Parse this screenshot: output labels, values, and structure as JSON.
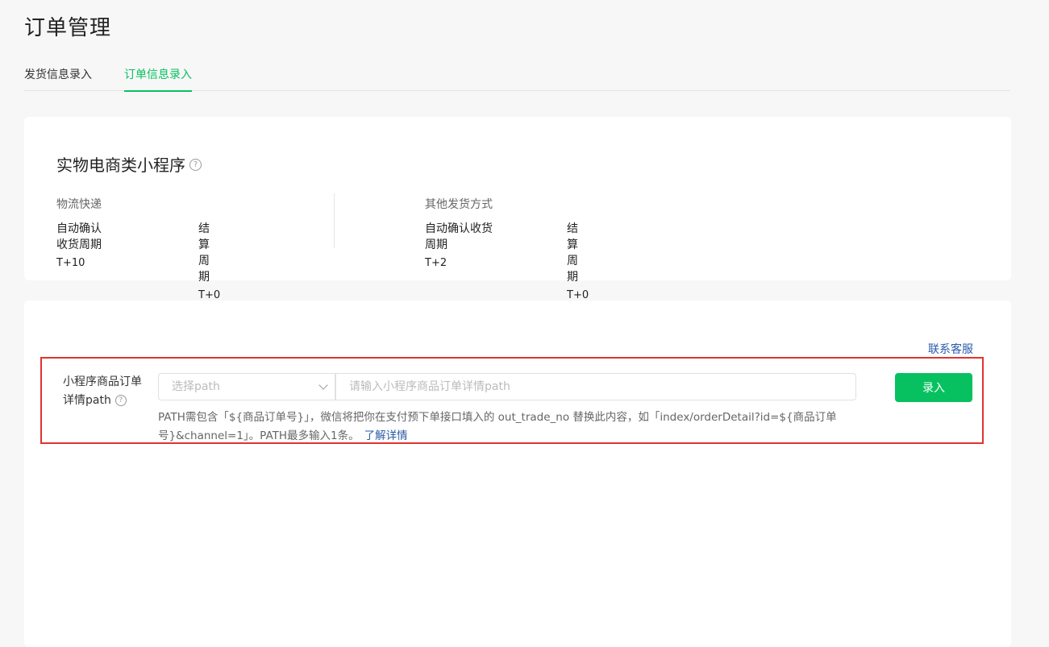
{
  "page": {
    "title": "订单管理"
  },
  "tabs": [
    {
      "label": "发货信息录入",
      "active": false
    },
    {
      "label": "订单信息录入",
      "active": true
    }
  ],
  "summary": {
    "title": "实物电商类小程序",
    "help_icon": "question-circle-icon",
    "logistics": {
      "heading": "物流快递",
      "confirm_label": "自动确认收货周期",
      "confirm_value": "T+10",
      "settle_label": "结算周期",
      "settle_value": "T+0"
    },
    "other": {
      "heading": "其他发货方式",
      "confirm_label": "自动确认收货周期",
      "confirm_value": "T+2",
      "settle_label": "结算周期",
      "settle_value": "T+0"
    }
  },
  "form": {
    "contact_link": "联系客服",
    "label_line1": "小程序商品订单",
    "label_line2": "详情path",
    "select_placeholder": "选择path",
    "input_placeholder": "请输入小程序商品订单详情path",
    "submit_label": "录入",
    "hint": "PATH需包含「${商品订单号}」，微信将把你在支付预下单接口填入的 out_trade_no 替换此内容，如「index/orderDetail?id=${商品订单号}&channel=1」。PATH最多输入1条。",
    "learn_more": "了解详情"
  },
  "colors": {
    "accent": "#07c160",
    "link": "#2a5aa8",
    "highlight": "#e0332f"
  }
}
